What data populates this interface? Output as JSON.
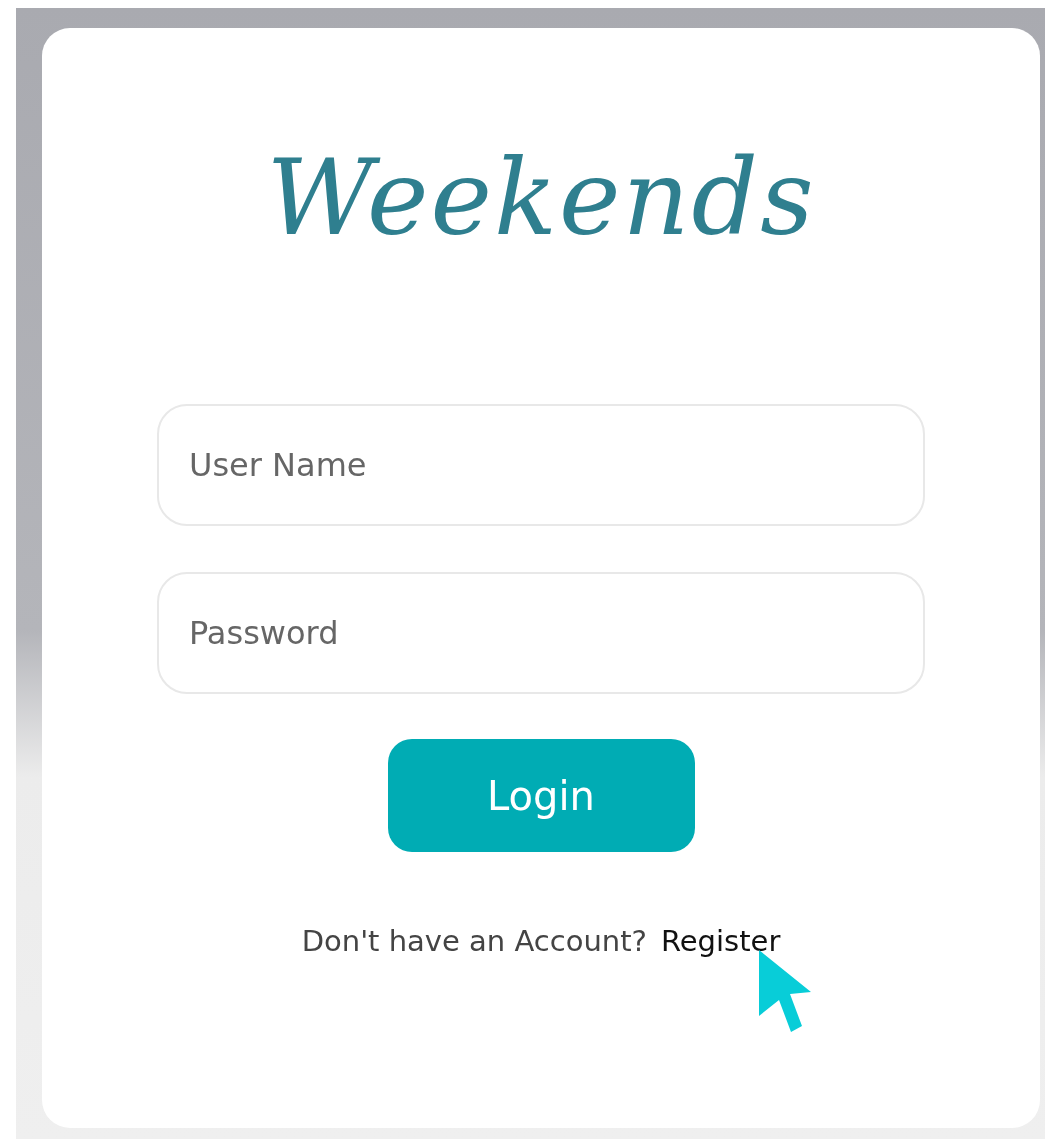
{
  "logo": {
    "text": "Weekends"
  },
  "fields": [
    {
      "placeholder": "User Name"
    },
    {
      "placeholder": "Password"
    }
  ],
  "login_button": {
    "label": "Login"
  },
  "register_prompt": {
    "text": "Don't have an Account?",
    "link": "Register"
  }
}
